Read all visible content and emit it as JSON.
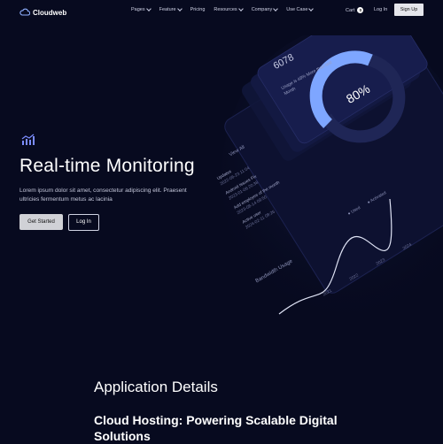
{
  "brand": {
    "name": "Cloudweb"
  },
  "nav": {
    "items": [
      {
        "label": "Pages",
        "has_dropdown": true
      },
      {
        "label": "Feature",
        "has_dropdown": true
      },
      {
        "label": "Pricing",
        "has_dropdown": false
      },
      {
        "label": "Resources",
        "has_dropdown": true
      },
      {
        "label": "Company",
        "has_dropdown": true
      },
      {
        "label": "Use Case",
        "has_dropdown": true
      }
    ],
    "cart_label": "Cart",
    "cart_count": "0",
    "login_label": "Log In",
    "signup_label": "Sign Up"
  },
  "hero": {
    "icon": "chart-analytics-icon",
    "title": "Real-time Monitoring",
    "subtitle": "Lorem ipsum dolor sit amet, consectetur adipiscing elit. Praesent ultricies fermentum metus ac lacinia",
    "primary_button": "Get Started",
    "secondary_button": "Log In"
  },
  "dashboard": {
    "stat_value": "6078",
    "stat_caption_1": "Usage is 48% More than last",
    "stat_caption_2": "Month",
    "gauge_label": "80%",
    "gauge_percent": 80,
    "panel_label": "View All",
    "chart_title": "Bandwidth Usage",
    "legend": [
      "Used",
      "Activated"
    ],
    "years": [
      "2021",
      "2022",
      "2023",
      "2024"
    ],
    "list_items": [
      {
        "title": "Updates",
        "sub": "2022-06-23 11:04"
      },
      {
        "title": "Android Issues Fix",
        "sub": "2023-01-06 20:38"
      },
      {
        "title": "Add employee of the month",
        "sub": "2023-08-14 09:50"
      },
      {
        "title": "Active user",
        "sub": "2024-02-11 08:26"
      }
    ]
  },
  "section": {
    "title": "Application Details",
    "subtitle": "Cloud Hosting: Powering Scalable Digital Solutions"
  },
  "colors": {
    "background": "#070a1f",
    "gauge_accent": "#7ea6ff",
    "icon_accent": "#7b8cff"
  }
}
